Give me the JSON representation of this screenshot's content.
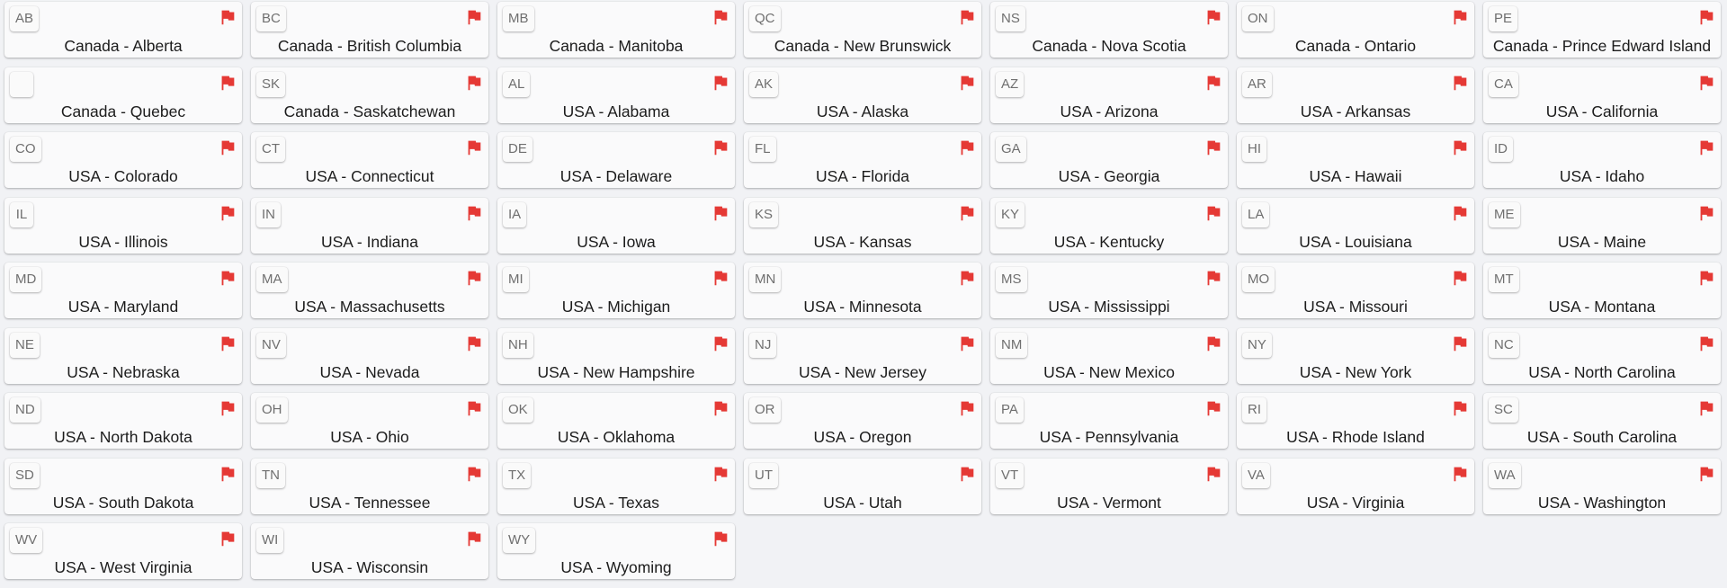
{
  "flag_color": "#e53935",
  "tiles": [
    {
      "code": "AB",
      "label": "Canada - Alberta"
    },
    {
      "code": "BC",
      "label": "Canada - British Columbia"
    },
    {
      "code": "MB",
      "label": "Canada - Manitoba"
    },
    {
      "code": "QC",
      "label": "Canada - New Brunswick"
    },
    {
      "code": "NS",
      "label": "Canada - Nova Scotia"
    },
    {
      "code": "ON",
      "label": "Canada - Ontario"
    },
    {
      "code": "PE",
      "label": "Canada - Prince Edward Island"
    },
    {
      "code": "",
      "label": "Canada - Quebec"
    },
    {
      "code": "SK",
      "label": "Canada - Saskatchewan"
    },
    {
      "code": "AL",
      "label": "USA - Alabama"
    },
    {
      "code": "AK",
      "label": "USA - Alaska"
    },
    {
      "code": "AZ",
      "label": "USA - Arizona"
    },
    {
      "code": "AR",
      "label": "USA - Arkansas"
    },
    {
      "code": "CA",
      "label": "USA - California"
    },
    {
      "code": "CO",
      "label": "USA - Colorado"
    },
    {
      "code": "CT",
      "label": "USA - Connecticut"
    },
    {
      "code": "DE",
      "label": "USA - Delaware"
    },
    {
      "code": "FL",
      "label": "USA - Florida"
    },
    {
      "code": "GA",
      "label": "USA - Georgia"
    },
    {
      "code": "HI",
      "label": "USA - Hawaii"
    },
    {
      "code": "ID",
      "label": "USA - Idaho"
    },
    {
      "code": "IL",
      "label": "USA - Illinois"
    },
    {
      "code": "IN",
      "label": "USA - Indiana"
    },
    {
      "code": "IA",
      "label": "USA - Iowa"
    },
    {
      "code": "KS",
      "label": "USA - Kansas"
    },
    {
      "code": "KY",
      "label": "USA - Kentucky"
    },
    {
      "code": "LA",
      "label": "USA - Louisiana"
    },
    {
      "code": "ME",
      "label": "USA - Maine"
    },
    {
      "code": "MD",
      "label": "USA - Maryland"
    },
    {
      "code": "MA",
      "label": "USA - Massachusetts"
    },
    {
      "code": "MI",
      "label": "USA - Michigan"
    },
    {
      "code": "MN",
      "label": "USA - Minnesota"
    },
    {
      "code": "MS",
      "label": "USA - Mississippi"
    },
    {
      "code": "MO",
      "label": "USA - Missouri"
    },
    {
      "code": "MT",
      "label": "USA - Montana"
    },
    {
      "code": "NE",
      "label": "USA - Nebraska"
    },
    {
      "code": "NV",
      "label": "USA - Nevada"
    },
    {
      "code": "NH",
      "label": "USA - New Hampshire"
    },
    {
      "code": "NJ",
      "label": "USA - New Jersey"
    },
    {
      "code": "NM",
      "label": "USA - New Mexico"
    },
    {
      "code": "NY",
      "label": "USA - New York"
    },
    {
      "code": "NC",
      "label": "USA - North Carolina"
    },
    {
      "code": "ND",
      "label": "USA - North Dakota"
    },
    {
      "code": "OH",
      "label": "USA - Ohio"
    },
    {
      "code": "OK",
      "label": "USA - Oklahoma"
    },
    {
      "code": "OR",
      "label": "USA - Oregon"
    },
    {
      "code": "PA",
      "label": "USA - Pennsylvania"
    },
    {
      "code": "RI",
      "label": "USA - Rhode Island"
    },
    {
      "code": "SC",
      "label": "USA - South Carolina"
    },
    {
      "code": "SD",
      "label": "USA - South Dakota"
    },
    {
      "code": "TN",
      "label": "USA - Tennessee"
    },
    {
      "code": "TX",
      "label": "USA - Texas"
    },
    {
      "code": "UT",
      "label": "USA - Utah"
    },
    {
      "code": "VT",
      "label": "USA - Vermont"
    },
    {
      "code": "VA",
      "label": "USA - Virginia"
    },
    {
      "code": "WA",
      "label": "USA - Washington"
    },
    {
      "code": "WV",
      "label": "USA - West Virginia"
    },
    {
      "code": "WI",
      "label": "USA - Wisconsin"
    },
    {
      "code": "WY",
      "label": "USA - Wyoming"
    }
  ]
}
